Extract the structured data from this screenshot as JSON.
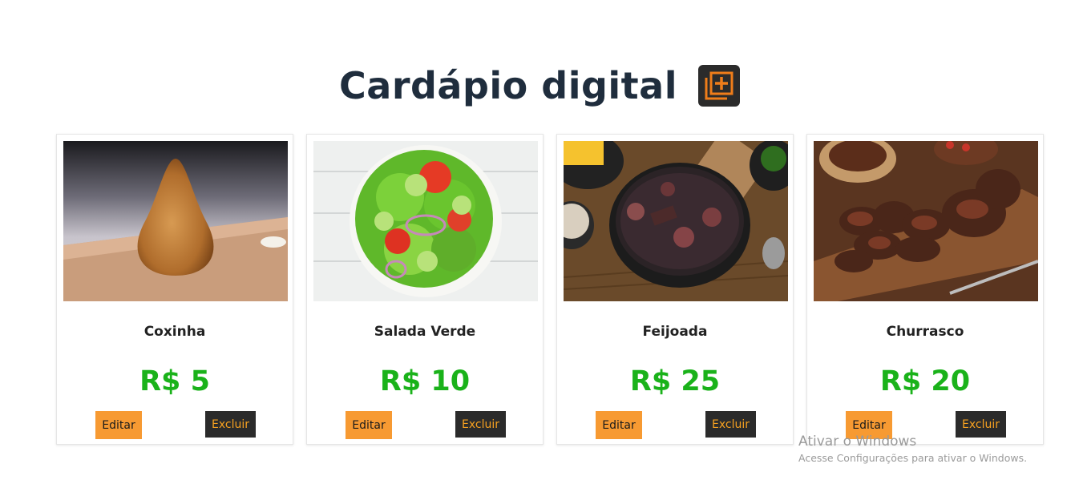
{
  "header": {
    "title": "Cardápio digital",
    "add_icon": "add-square-icon"
  },
  "colors": {
    "title": "#1f2d3d",
    "price": "#1ab21a",
    "edit_bg": "#f79a32",
    "delete_bg": "#2b2b2b",
    "delete_text": "#f5a020",
    "icon_accent": "#ef7d1a"
  },
  "cards": [
    {
      "name": "Coxinha",
      "price": "R$ 5",
      "edit_label": "Editar",
      "delete_label": "Excluir"
    },
    {
      "name": "Salada Verde",
      "price": "R$ 10",
      "edit_label": "Editar",
      "delete_label": "Excluir"
    },
    {
      "name": "Feijoada",
      "price": "R$ 25",
      "edit_label": "Editar",
      "delete_label": "Excluir"
    },
    {
      "name": "Churrasco",
      "price": "R$ 20",
      "edit_label": "Editar",
      "delete_label": "Excluir"
    }
  ],
  "watermark": {
    "line1": "Ativar o Windows",
    "line2": "Acesse Configurações para ativar o Windows."
  }
}
